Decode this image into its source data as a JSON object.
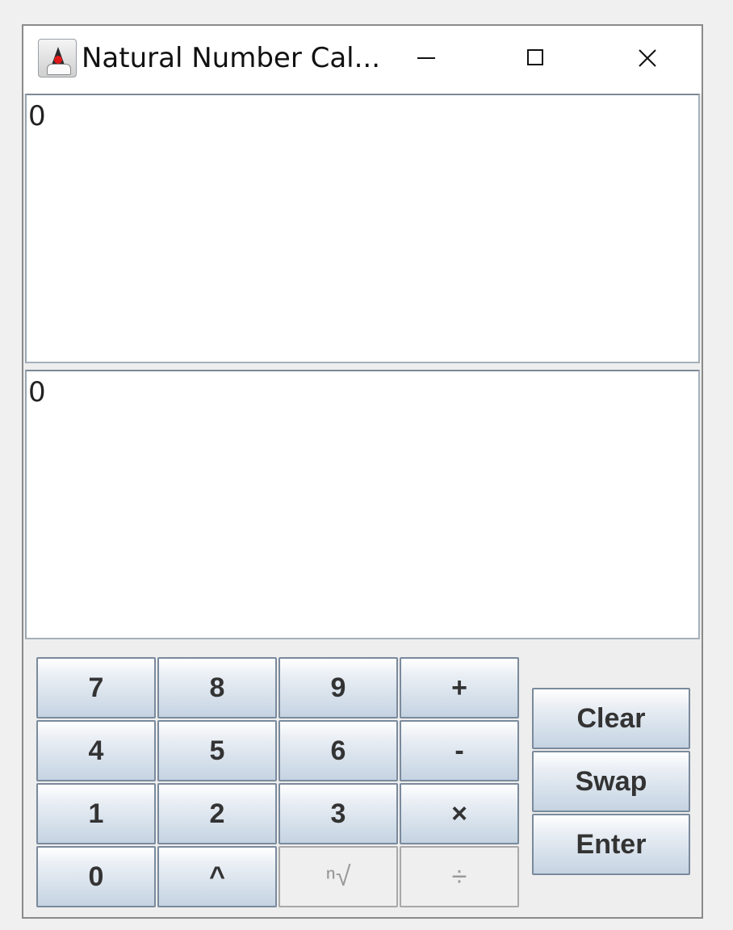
{
  "window": {
    "title": "Natural Number Cal..."
  },
  "displays": {
    "top_value": "0",
    "bottom_value": "0"
  },
  "keypad": {
    "rows": [
      [
        "7",
        "8",
        "9",
        "+"
      ],
      [
        "4",
        "5",
        "6",
        "-"
      ],
      [
        "1",
        "2",
        "3",
        "×"
      ],
      [
        "0",
        "^",
        "ⁿ√",
        "÷"
      ]
    ],
    "disabled": [
      "ⁿ√",
      "÷"
    ]
  },
  "side_buttons": {
    "clear": "Clear",
    "swap": "Swap",
    "enter": "Enter"
  },
  "icons": {
    "app": "java-duke-icon",
    "minimize": "minimize-icon",
    "maximize": "maximize-icon",
    "close": "close-icon"
  },
  "colors": {
    "button_top": "#ffffff",
    "button_bottom": "#c5d3e2",
    "button_border": "#7a8a9c",
    "disabled_text": "#9a9a9a"
  }
}
